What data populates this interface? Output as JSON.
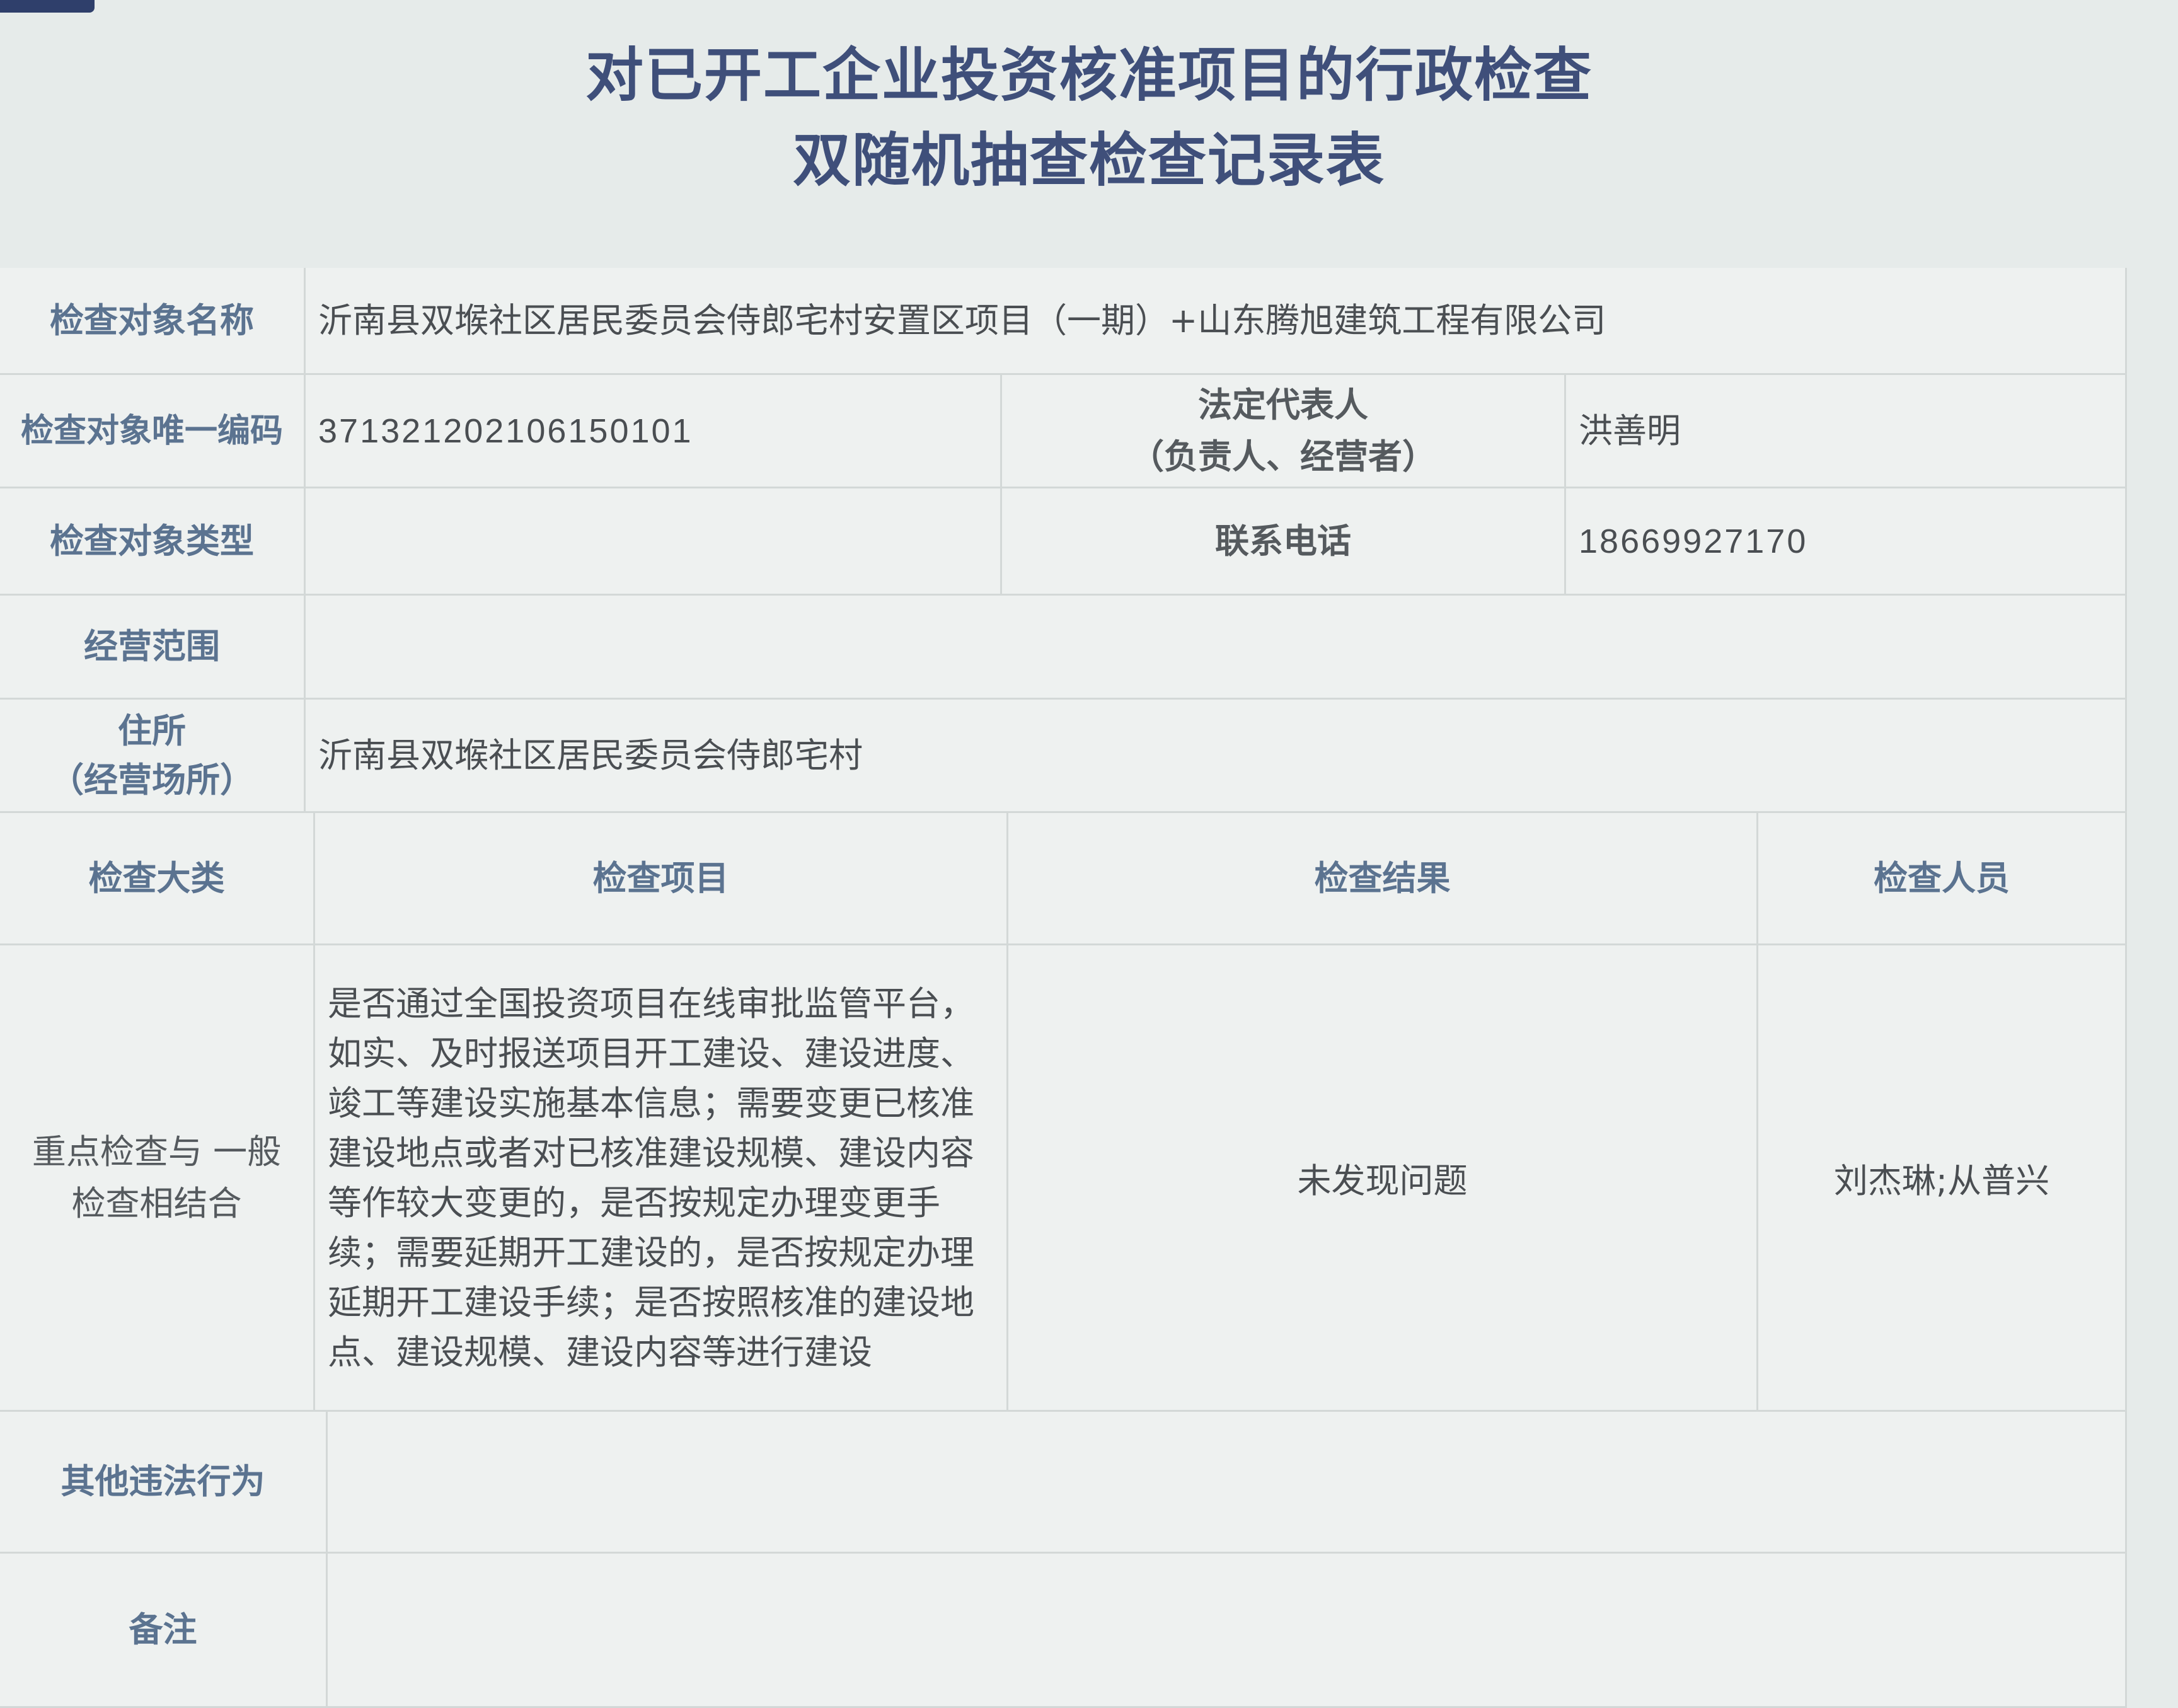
{
  "title": {
    "line1": "对已开工企业投资核准项目的行政检查",
    "line2": "双随机抽查检查记录表"
  },
  "subject": {
    "name_label": "检查对象名称",
    "name_value": "沂南县双堠社区居民委员会侍郎宅村安置区项目（一期）+山东腾旭建筑工程有限公司",
    "code_label": "检查对象唯一编码",
    "code_value": "371321202106150101",
    "legal_rep_label_line1": "法定代表人",
    "legal_rep_label_line2": "（负责人、经营者）",
    "legal_rep_value": "洪善明",
    "type_label": "检查对象类型",
    "type_value": "",
    "phone_label": "联系电话",
    "phone_value": "18669927170",
    "scope_label": "经营范围",
    "scope_value": "",
    "address_label_line1": "住所",
    "address_label_line2": "（经营场所）",
    "address_value": "沂南县双堠社区居民委员会侍郎宅村"
  },
  "inspection_table": {
    "headers": [
      "检查大类",
      "检查项目",
      "检查结果",
      "检查人员"
    ],
    "row": {
      "category_line1": "重点检查与 一般",
      "category_line2": "检查相结合",
      "item": "是否通过全国投资项目在线审批监管平台，如实、及时报送项目开工建设、建设进度、竣工等建设实施基本信息；需要变更已核准建设地点或者对已核准建设规模、建设内容等作较大变更的，是否按规定办理变更手续；需要延期开工建设的，是否按规定办理延期开工建设手续；是否按照核准的建设地点、建设规模、建设内容等进行建设",
      "result": "未发现问题",
      "inspectors": "刘杰琳;从普兴"
    }
  },
  "other_violations": {
    "label": "其他违法行为",
    "value": ""
  },
  "remarks": {
    "label": "备注",
    "value": ""
  }
}
